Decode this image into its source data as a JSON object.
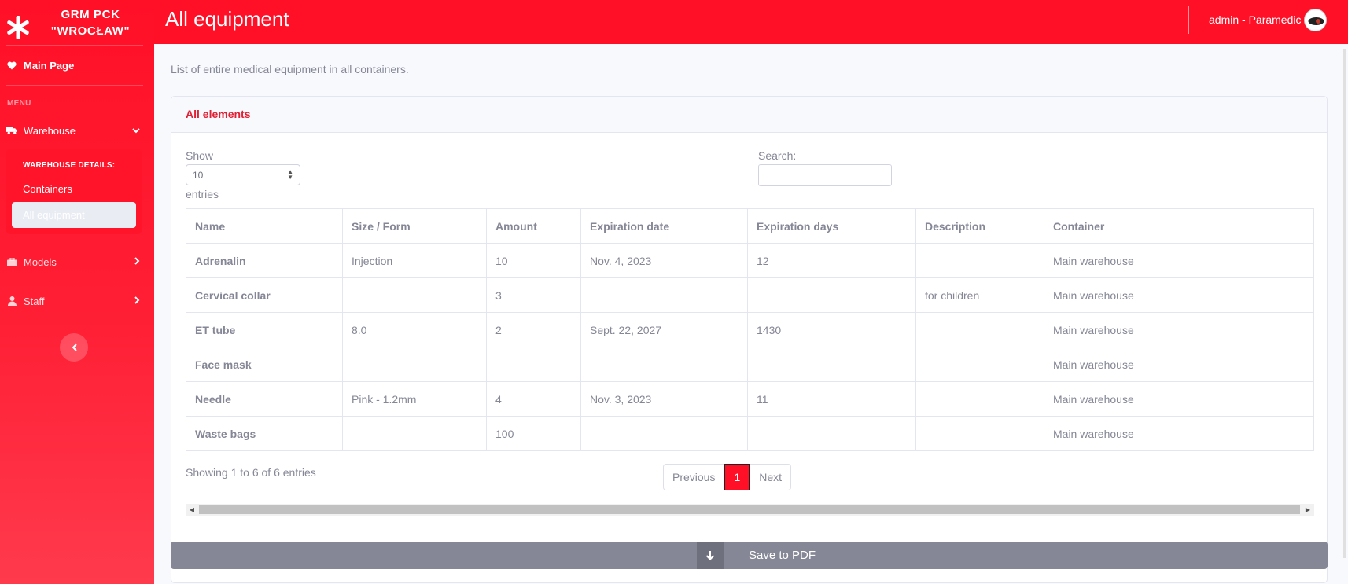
{
  "brand": {
    "name": "GRM PCK \"WROCŁAW\"",
    "logo": "asterisk-icon"
  },
  "sidebar": {
    "main_page": "Main Page",
    "menu_heading": "MENU",
    "warehouse": "Warehouse",
    "warehouse_details_heading": "WAREHOUSE DETAILS:",
    "submenu": [
      "Containers",
      "All equipment"
    ],
    "models": "Models",
    "staff": "Staff"
  },
  "header": {
    "title": "All equipment",
    "user": "admin - Paramedic"
  },
  "main": {
    "intro": "List of entire medical equipment in all containers.",
    "card_title": "All elements",
    "show_label": "Show",
    "page_size": "10",
    "entries_label": "entries",
    "search_label": "Search:",
    "search_value": "",
    "columns": [
      "Name",
      "Size / Form",
      "Amount",
      "Expiration date",
      "Expiration days",
      "Description",
      "Container"
    ],
    "rows": [
      [
        "Adrenalin",
        "Injection",
        "10",
        "Nov. 4, 2023",
        "12",
        "",
        "Main warehouse"
      ],
      [
        "Cervical collar",
        "",
        "3",
        "",
        "",
        "for children",
        "Main warehouse"
      ],
      [
        "ET tube",
        "8.0",
        "2",
        "Sept. 22, 2027",
        "1430",
        "",
        "Main warehouse"
      ],
      [
        "Face mask",
        "",
        "",
        "",
        "",
        "",
        "Main warehouse"
      ],
      [
        "Needle",
        "Pink - 1.2mm",
        "4",
        "Nov. 3, 2023",
        "11",
        "",
        "Main warehouse"
      ],
      [
        "Waste bags",
        "",
        "100",
        "",
        "",
        "",
        "Main warehouse"
      ]
    ],
    "info": "Showing 1 to 6 of 6 entries",
    "pager": {
      "previous": "Previous",
      "current": "1",
      "next": "Next"
    },
    "pdf_button": "Save to PDF"
  },
  "colors": {
    "accent": "#ff1027",
    "text": "#858796",
    "button_gray": "#858796"
  }
}
